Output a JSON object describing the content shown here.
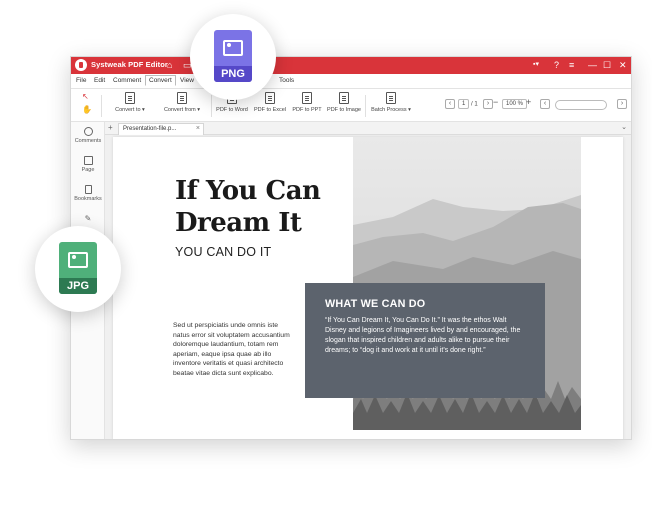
{
  "app": {
    "title": "Systweak PDF Editor",
    "accent_color": "#d9343a"
  },
  "titlebar_icons": [
    "home-icon",
    "folder-icon",
    "flag-icon",
    "help-icon",
    "more-icon"
  ],
  "window_controls": {
    "minimize": "—",
    "maximize": "☐",
    "close": "✕"
  },
  "menu": {
    "items": [
      "File",
      "Edit",
      "Comment",
      "Convert",
      "View",
      "Protect",
      "Forms",
      "Tools"
    ],
    "active": "Convert"
  },
  "toolbar": {
    "convert_to": "Convert to",
    "convert_from": "Convert from",
    "pdf_to_word": "PDF to Word",
    "pdf_to_excel": "PDF to Excel",
    "pdf_to_ppt": "PDF to PPT",
    "pdf_to_image": "PDF to Image",
    "batch_process": "Batch Process",
    "page_current": "1",
    "page_total": "/ 1",
    "zoom": "100 %"
  },
  "sidebar": {
    "items": [
      "Comments",
      "Page",
      "Bookmarks"
    ]
  },
  "tabs": {
    "document": "Presentation-file.p..."
  },
  "document": {
    "title_line1": "If You Can",
    "title_line2": "Dream It",
    "subtitle": "YOU CAN DO IT",
    "body": "Sed ut perspiciatis unde omnis iste natus error sit voluptatem accusantium doloremque laudantium, totam rem aperiam, eaque ipsa quae ab illo inventore veritatis et quasi architecto beatae vitae dicta sunt explicabo.",
    "box_title": "WHAT WE CAN DO",
    "box_body": "“If You Can Dream It, You Can Do It.” It was the ethos Walt Disney and legions of Imagineers lived by and encouraged, the slogan that inspired children and adults alike to pursue their dreams; to “dog it and work at it until it’s done right.”"
  },
  "badges": {
    "png": {
      "label": "PNG",
      "color": "#6c63d9"
    },
    "jpg": {
      "label": "JPG",
      "color": "#2f8f5f"
    }
  }
}
